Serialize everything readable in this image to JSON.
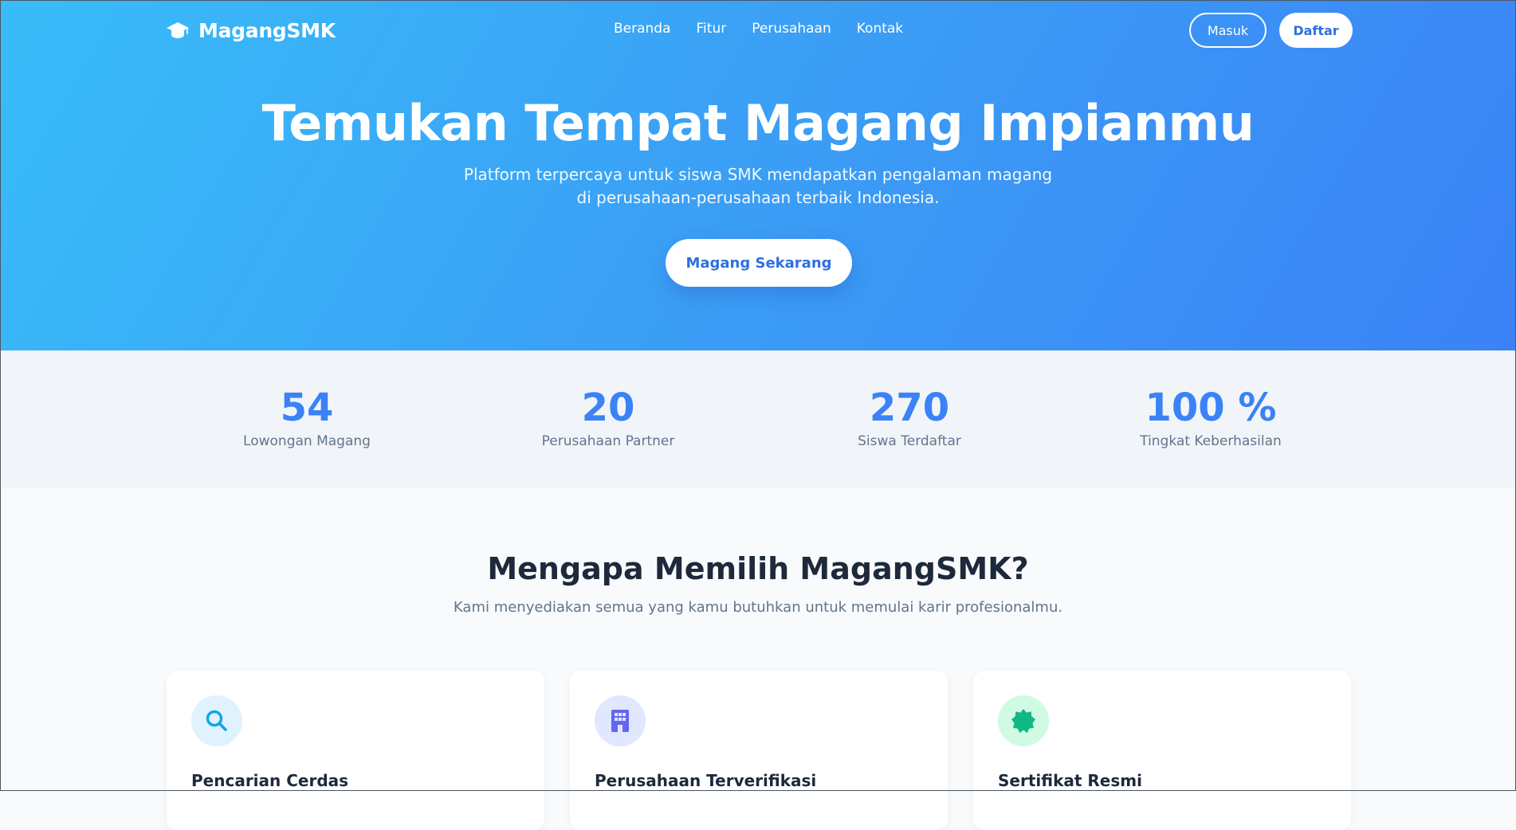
{
  "brand": {
    "name": "MagangSMK",
    "icon": "graduation-cap-icon"
  },
  "nav": {
    "links": [
      "Beranda",
      "Fitur",
      "Perusahaan",
      "Kontak"
    ],
    "login_label": "Masuk",
    "register_label": "Daftar"
  },
  "hero": {
    "title": "Temukan Tempat Magang Impianmu",
    "subtitle_line1": "Platform terpercaya untuk siswa SMK mendapatkan pengalaman magang",
    "subtitle_line2": "di perusahaan-perusahaan terbaik Indonesia.",
    "cta_label": "Magang Sekarang"
  },
  "stats": [
    {
      "value": "54",
      "label": "Lowongan Magang"
    },
    {
      "value": "20",
      "label": "Perusahaan Partner"
    },
    {
      "value": "270",
      "label": "Siswa Terdaftar"
    },
    {
      "value": "100 %",
      "label": "Tingkat Keberhasilan"
    }
  ],
  "features": {
    "title": "Mengapa Memilih MagangSMK?",
    "subtitle": "Kami menyediakan semua yang kamu butuhkan untuk memulai karir profesionalmu.",
    "cards": [
      {
        "title": "Pencarian Cerdas",
        "icon": "search-icon"
      },
      {
        "title": "Perusahaan Terverifikasi",
        "icon": "building-icon"
      },
      {
        "title": "Sertifikat Resmi",
        "icon": "certificate-badge-icon"
      }
    ]
  },
  "colors": {
    "hero_gradient_start": "#38bdf8",
    "hero_gradient_end": "#3b82f6",
    "accent": "#3b82f6",
    "stats_background": "#f1f5f9",
    "icon_search_bg": "#e0f2fe",
    "icon_building_bg": "#e0e7ff",
    "icon_certificate_bg": "#d1fae5"
  }
}
